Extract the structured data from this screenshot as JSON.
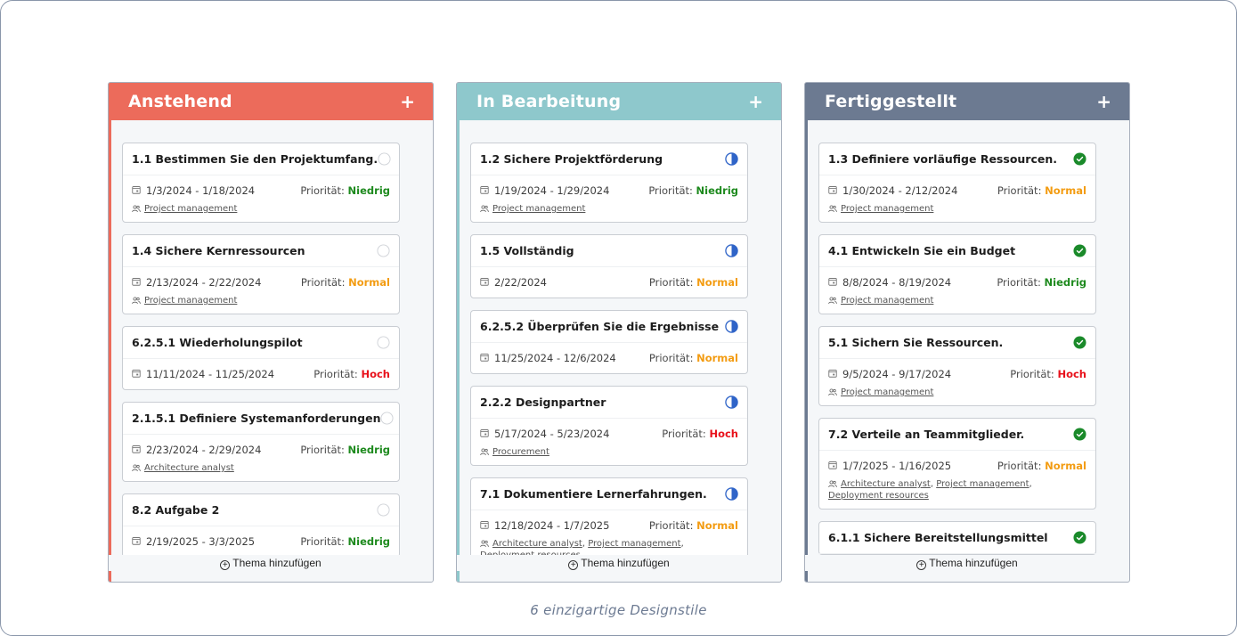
{
  "colors": {
    "pending": "#ec6b5b",
    "in_progress": "#8ec8cc",
    "done": "#6c7a91",
    "priority_low": "#1e8a1e",
    "priority_normal": "#f39c12",
    "priority_high": "#e8111b",
    "progress_icon": "#2f64c8",
    "done_icon": "#1a8a2a"
  },
  "columns": [
    {
      "title": "Anstehend",
      "status": "pending",
      "add_label": "+",
      "add_topic_label": "Thema hinzufügen",
      "cards": [
        {
          "title": "1.1 Bestimmen Sie den Projektumfang.",
          "dates": "1/3/2024 - 1/18/2024",
          "priority_label": "Priorität:",
          "priority": "Niedrig",
          "priority_level": "low",
          "resources": [
            "Project management"
          ]
        },
        {
          "title": "1.4 Sichere Kernressourcen",
          "dates": "2/13/2024 - 2/22/2024",
          "priority_label": "Priorität:",
          "priority": "Normal",
          "priority_level": "normal",
          "resources": [
            "Project management"
          ]
        },
        {
          "title": "6.2.5.1 Wiederholungspilot",
          "dates": "11/11/2024 - 11/25/2024",
          "priority_label": "Priorität:",
          "priority": "Hoch",
          "priority_level": "high",
          "resources": []
        },
        {
          "title": "2.1.5.1 Definiere Systemanforderungen",
          "dates": "2/23/2024 - 2/29/2024",
          "priority_label": "Priorität:",
          "priority": "Niedrig",
          "priority_level": "low",
          "resources": [
            "Architecture analyst"
          ]
        },
        {
          "title": "8.2 Aufgabe 2",
          "dates": "2/19/2025 - 3/3/2025",
          "priority_label": "Priorität:",
          "priority": "Niedrig",
          "priority_level": "low",
          "resources": []
        }
      ]
    },
    {
      "title": "In Bearbeitung",
      "status": "in_progress",
      "add_label": "+",
      "add_topic_label": "Thema hinzufügen",
      "cards": [
        {
          "title": "1.2 Sichere Projektförderung",
          "dates": "1/19/2024 - 1/29/2024",
          "priority_label": "Priorität:",
          "priority": "Niedrig",
          "priority_level": "low",
          "resources": [
            "Project management"
          ]
        },
        {
          "title": "1.5 Vollständig",
          "dates": "2/22/2024",
          "priority_label": "Priorität:",
          "priority": "Normal",
          "priority_level": "normal",
          "resources": []
        },
        {
          "title": "6.2.5.2 Überprüfen Sie die Ergebnisse",
          "dates": "11/25/2024 - 12/6/2024",
          "priority_label": "Priorität:",
          "priority": "Normal",
          "priority_level": "normal",
          "resources": []
        },
        {
          "title": "2.2.2 Designpartner",
          "dates": "5/17/2024 - 5/23/2024",
          "priority_label": "Priorität:",
          "priority": "Hoch",
          "priority_level": "high",
          "resources": [
            "Procurement"
          ]
        },
        {
          "title": "7.1 Dokumentiere Lernerfahrungen.",
          "dates": "12/18/2024 - 1/7/2025",
          "priority_label": "Priorität:",
          "priority": "Normal",
          "priority_level": "normal",
          "resources": [
            "Architecture analyst",
            "Project management",
            "Deployment resources"
          ]
        }
      ]
    },
    {
      "title": "Fertiggestellt",
      "status": "done",
      "add_label": "+",
      "add_topic_label": "Thema hinzufügen",
      "cards": [
        {
          "title": "1.3 Definiere vorläufige Ressourcen.",
          "dates": "1/30/2024 - 2/12/2024",
          "priority_label": "Priorität:",
          "priority": "Normal",
          "priority_level": "normal",
          "resources": [
            "Project management"
          ]
        },
        {
          "title": "4.1 Entwickeln Sie ein Budget",
          "dates": "8/8/2024 - 8/19/2024",
          "priority_label": "Priorität:",
          "priority": "Niedrig",
          "priority_level": "low",
          "resources": [
            "Project management"
          ]
        },
        {
          "title": "5.1 Sichern Sie Ressourcen.",
          "dates": "9/5/2024 - 9/17/2024",
          "priority_label": "Priorität:",
          "priority": "Hoch",
          "priority_level": "high",
          "resources": [
            "Project management"
          ]
        },
        {
          "title": "7.2 Verteile an Teammitglieder.",
          "dates": "1/7/2025 - 1/16/2025",
          "priority_label": "Priorität:",
          "priority": "Normal",
          "priority_level": "normal",
          "resources": [
            "Architecture analyst",
            "Project management",
            "Deployment resources"
          ]
        },
        {
          "title": "6.1.1 Sichere Bereitstellungsmittel",
          "dates": "",
          "priority_label": "",
          "priority": "",
          "priority_level": "",
          "resources": []
        }
      ]
    }
  ],
  "caption": "6 einzigartige Designstile"
}
